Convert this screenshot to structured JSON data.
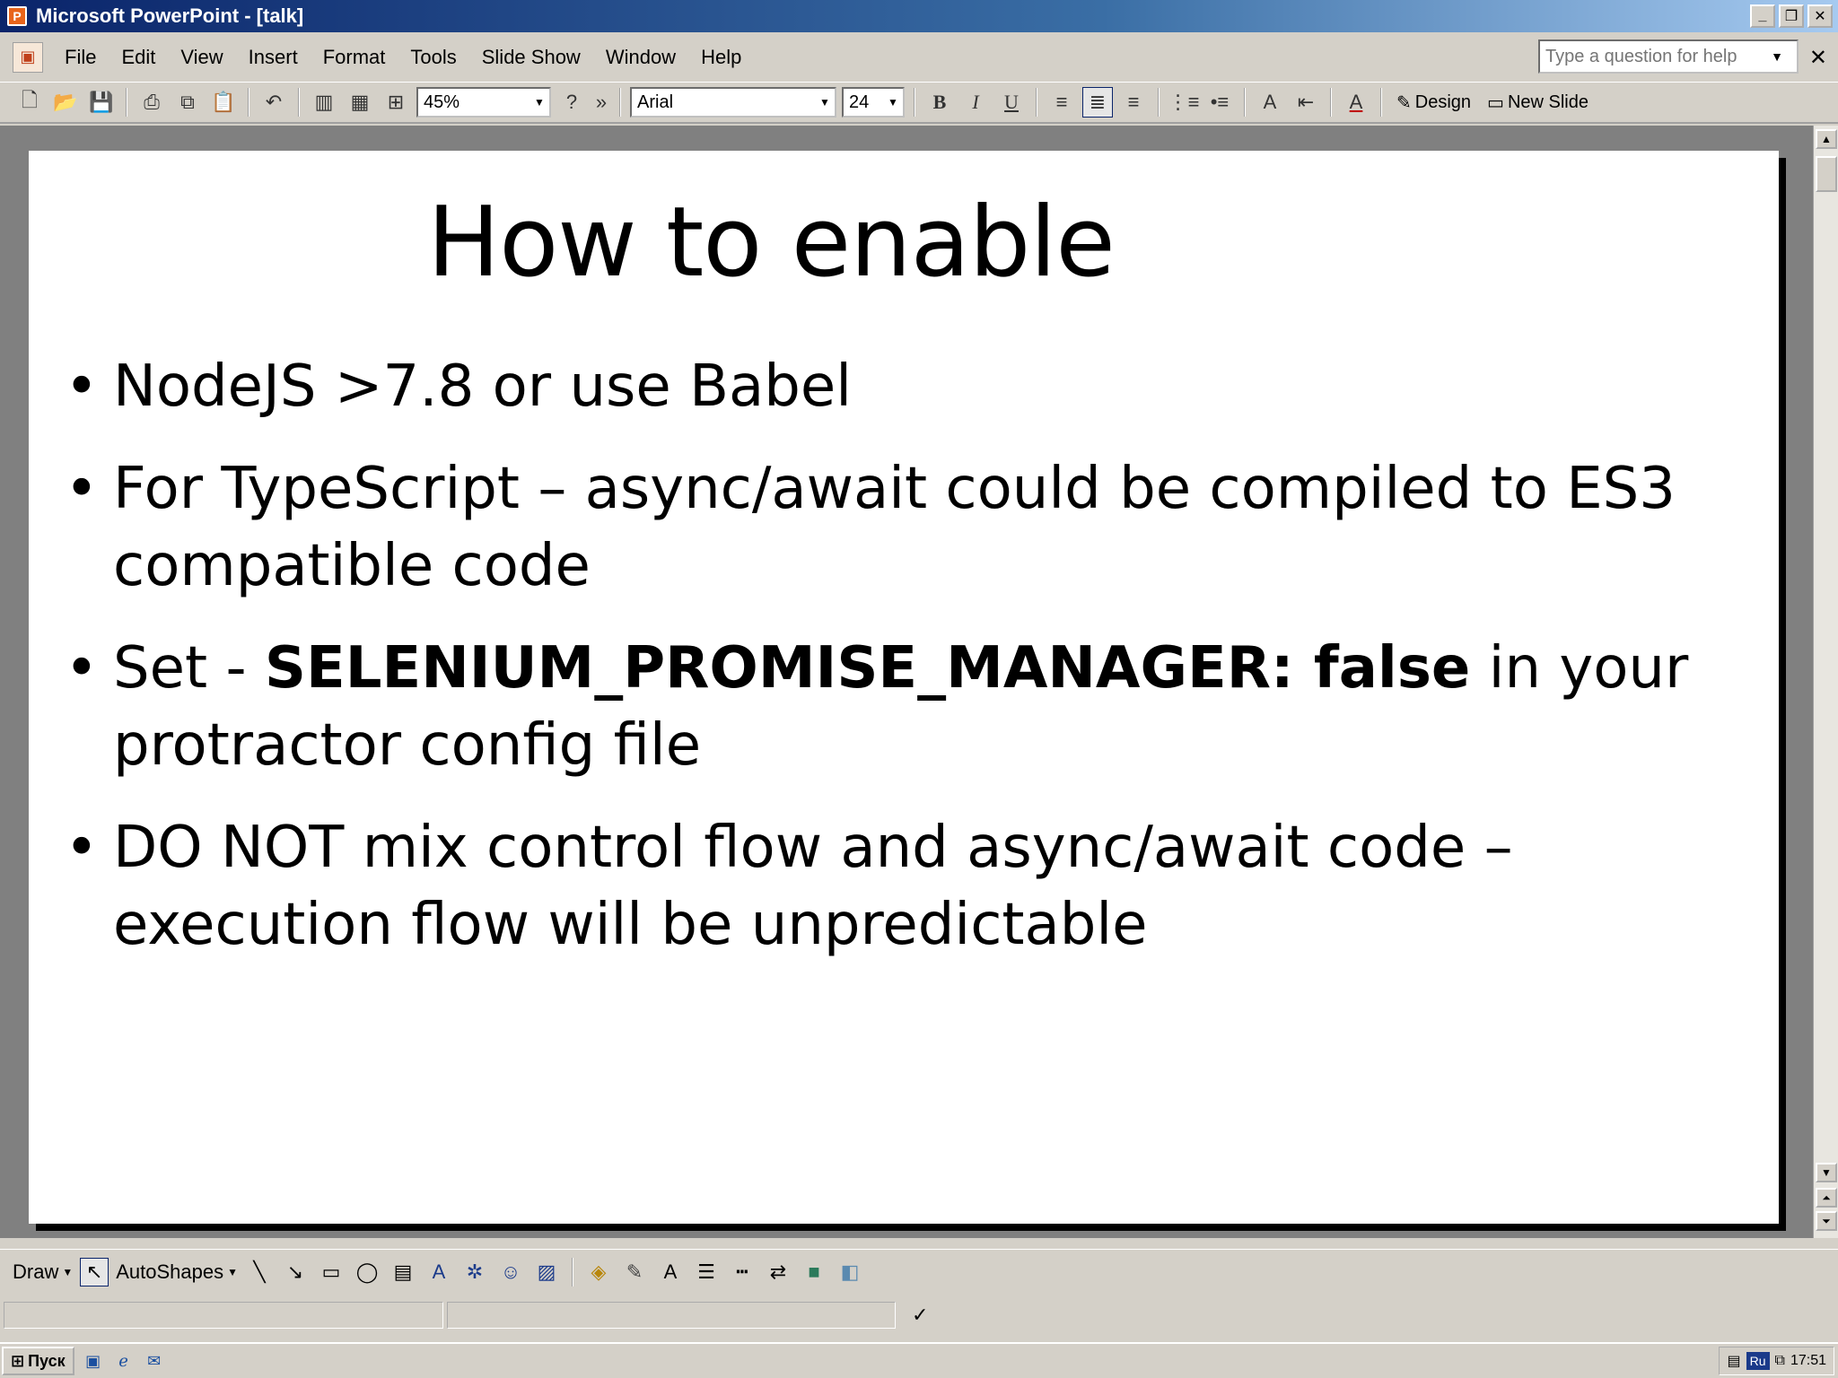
{
  "window": {
    "title": "Microsoft PowerPoint - [talk]",
    "buttons": {
      "minimize": "_",
      "restore": "❐",
      "close": "✕"
    }
  },
  "menubar": {
    "items": [
      "File",
      "Edit",
      "View",
      "Insert",
      "Format",
      "Tools",
      "Slide Show",
      "Window",
      "Help"
    ],
    "help_placeholder": "Type a question for help"
  },
  "toolbar": {
    "zoom": "45%",
    "font": "Arial",
    "font_size": "24",
    "bold": "B",
    "italic": "I",
    "underline": "U",
    "design_label": "Design",
    "new_slide_label": "New Slide"
  },
  "slide": {
    "title": "How to enable",
    "bullets": [
      {
        "text": "NodeJS >7.8 or use Babel"
      },
      {
        "text": "For TypeScript – async/await could be compiled to ES3 compatible code"
      },
      {
        "pre": "Set - ",
        "bold": "SELENIUM_PROMISE_MANAGER: false",
        "post": " in your protractor config file"
      },
      {
        "text": "DO NOT mix control flow and async/await code – execution flow will be unpredictable"
      }
    ]
  },
  "drawbar": {
    "draw_label": "Draw",
    "autoshapes_label": "AutoShapes"
  },
  "taskbar": {
    "start_label": "Пуск",
    "lang": "Ru",
    "clock": "17:51"
  }
}
